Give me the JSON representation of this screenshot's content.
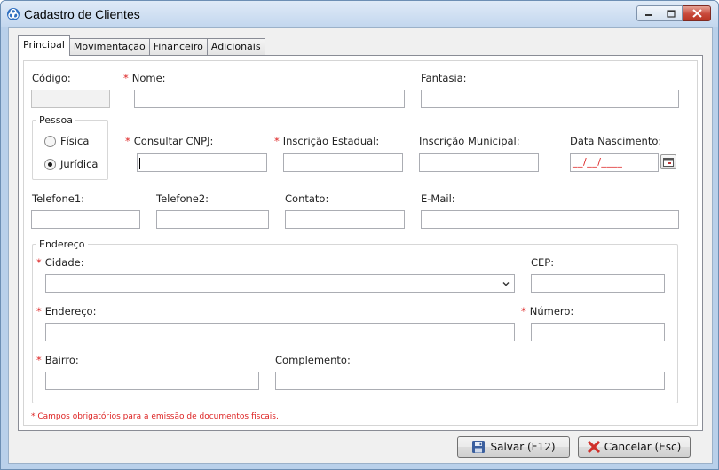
{
  "window": {
    "title": "Cadastro de Clientes"
  },
  "tabs": [
    {
      "label": "Principal",
      "active": true
    },
    {
      "label": "Movimentação",
      "active": false
    },
    {
      "label": "Financeiro",
      "active": false
    },
    {
      "label": "Adicionais",
      "active": false
    }
  ],
  "form": {
    "codigo_label": "Código:",
    "nome_label": "Nome:",
    "fantasia_label": "Fantasia:",
    "pessoa_group": "Pessoa",
    "pessoa_options": [
      {
        "label": "Física",
        "checked": false
      },
      {
        "label": "Jurídica",
        "checked": true
      }
    ],
    "cnpj_label": "Consultar CNPJ:",
    "ie_label": "Inscrição Estadual:",
    "im_label": "Inscrição Municipal:",
    "nascimento_label": "Data Nascimento:",
    "nascimento_mask": "__/__/____",
    "telefone1_label": "Telefone1:",
    "telefone2_label": "Telefone2:",
    "contato_label": "Contato:",
    "email_label": "E-Mail:",
    "endereco_group": "Endereço",
    "cidade_label": "Cidade:",
    "cep_label": "CEP:",
    "endereco_label": "Endereço:",
    "numero_label": "Número:",
    "bairro_label": "Bairro:",
    "complemento_label": "Complemento:",
    "required_mark": "*",
    "footnote": "* Campos obrigatórios para a emissão de documentos fiscais."
  },
  "buttons": {
    "save_label": "Salvar (F12)",
    "cancel_label": "Cancelar (Esc)"
  },
  "colors": {
    "required": "#dd2222",
    "save_icon": "#3b5f9e",
    "cancel_icon": "#d0302a"
  }
}
